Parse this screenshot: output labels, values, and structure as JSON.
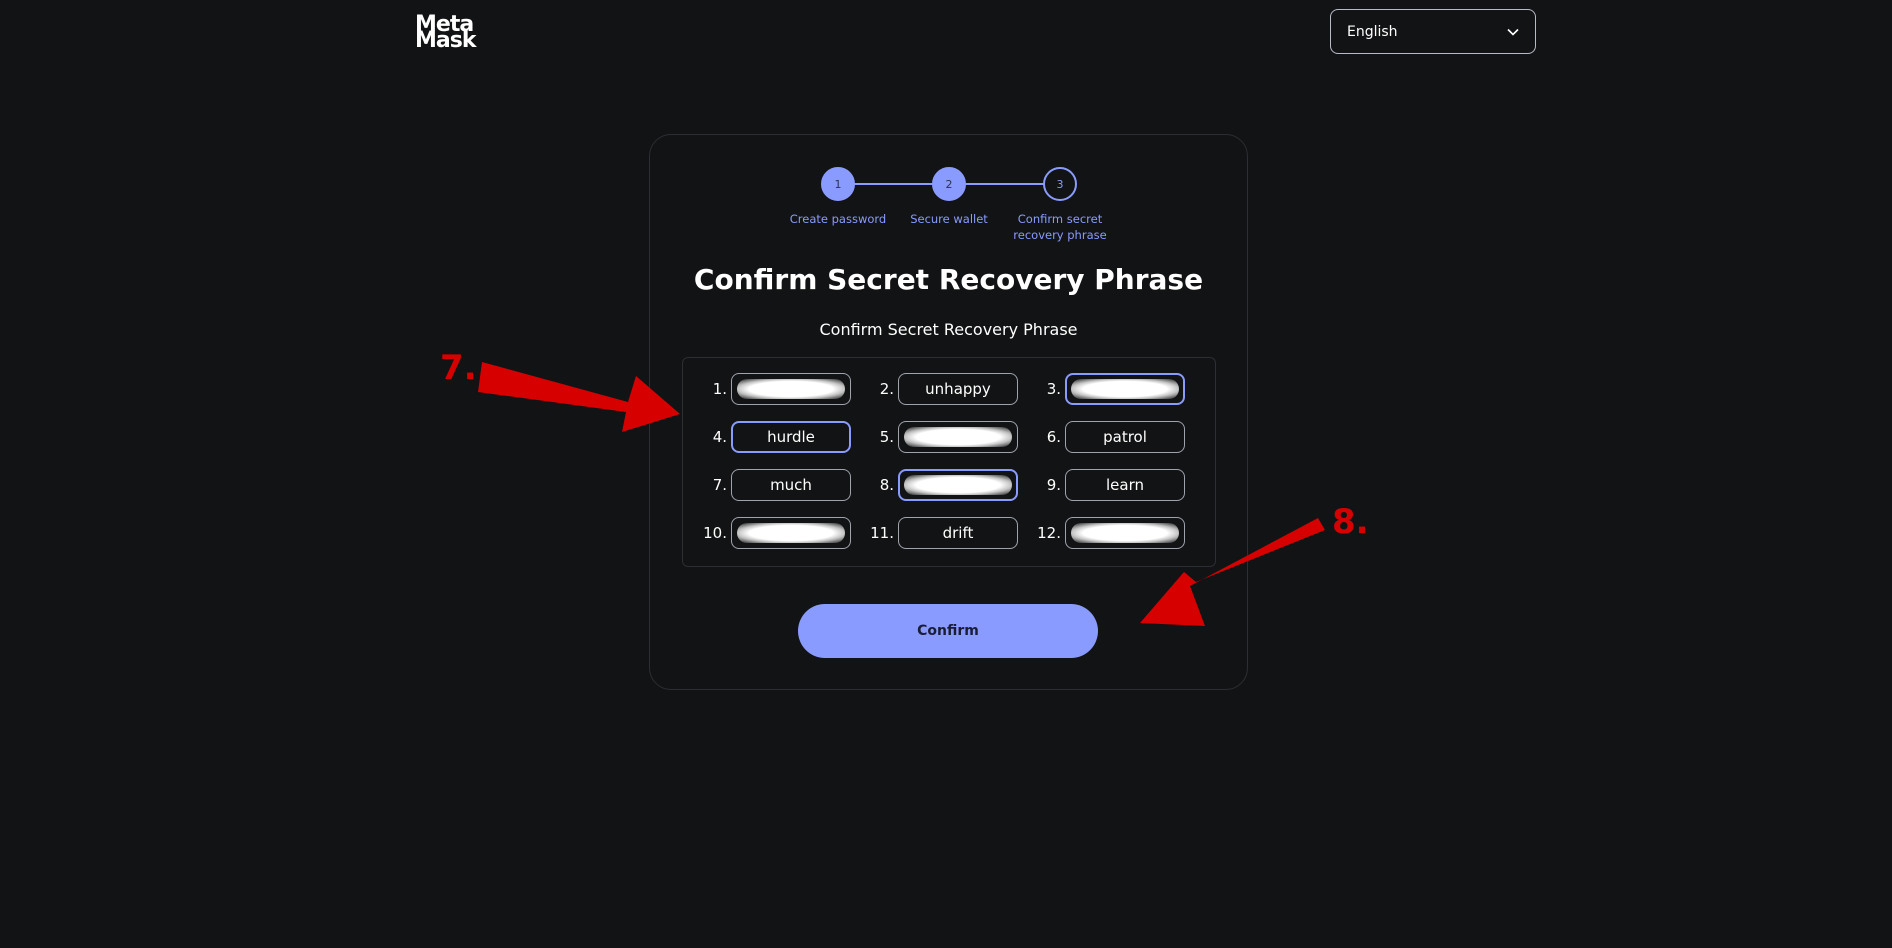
{
  "header": {
    "logo_line1": "Meta",
    "logo_line2": "Mask",
    "language": "English"
  },
  "stepper": {
    "steps": [
      {
        "number": "1",
        "label": "Create password"
      },
      {
        "number": "2",
        "label": "Secure wallet"
      },
      {
        "number": "3",
        "label": "Confirm secret recovery phrase"
      }
    ]
  },
  "card": {
    "title": "Confirm Secret Recovery Phrase",
    "subtitle": "Confirm Secret Recovery Phrase",
    "phrase": [
      {
        "num": "1.",
        "word": "",
        "hidden": true
      },
      {
        "num": "2.",
        "word": "unhappy"
      },
      {
        "num": "3.",
        "word": "",
        "hidden": true
      },
      {
        "num": "4.",
        "word": "hurdle"
      },
      {
        "num": "5.",
        "word": "",
        "hidden": true
      },
      {
        "num": "6.",
        "word": "patrol"
      },
      {
        "num": "7.",
        "word": "much"
      },
      {
        "num": "8.",
        "word": "",
        "hidden": true
      },
      {
        "num": "9.",
        "word": "learn"
      },
      {
        "num": "10.",
        "word": "",
        "hidden": true
      },
      {
        "num": "11.",
        "word": "drift"
      },
      {
        "num": "12.",
        "word": "",
        "hidden": true
      }
    ],
    "confirm_label": "Confirm"
  },
  "annotations": {
    "a7": "7.",
    "a8": "8."
  },
  "colors": {
    "background": "#121314",
    "accent": "#8a9bff",
    "annotation": "#d70000"
  }
}
